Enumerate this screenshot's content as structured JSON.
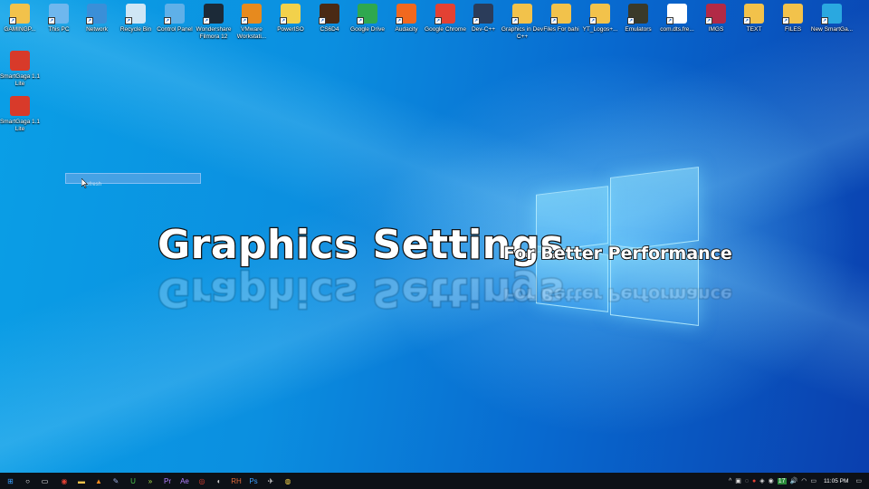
{
  "desktop": {
    "icons_top": [
      {
        "label": "GAMINGP...",
        "icon": "user-folder-icon",
        "color": "#f2c24b"
      },
      {
        "label": "This PC",
        "icon": "laptop-icon",
        "color": "#6fb7ee"
      },
      {
        "label": "Network",
        "icon": "network-globe-icon",
        "color": "#3a8fd8"
      },
      {
        "label": "Recycle Bin",
        "icon": "recycle-bin-icon",
        "color": "#cfe6f5"
      },
      {
        "label": "Control Panel",
        "icon": "control-panel-icon",
        "color": "#5fb0e8"
      },
      {
        "label": "Wondershare Filmora 12",
        "icon": "filmora-icon",
        "color": "#1c2a38"
      },
      {
        "label": "VMware Workstati...",
        "icon": "vmware-icon",
        "color": "#e78a1e"
      },
      {
        "label": "PowerISO",
        "icon": "poweriso-icon",
        "color": "#f2d14b"
      },
      {
        "label": "CS6D4",
        "icon": "cs6-game-icon",
        "color": "#4a2a14"
      },
      {
        "label": "Google Drive",
        "icon": "google-drive-icon",
        "color": "#2fa84f"
      },
      {
        "label": "Audacity",
        "icon": "audacity-icon",
        "color": "#f1681e"
      },
      {
        "label": "Google Chrome",
        "icon": "chrome-icon",
        "color": "#e34133"
      },
      {
        "label": "Dev-C++",
        "icon": "devcpp-icon",
        "color": "#2b3c5a"
      },
      {
        "label": "Graphics in Dev C++",
        "icon": "folder-icon",
        "color": "#f2c24b"
      },
      {
        "label": "Files For bahi",
        "icon": "folder-icon",
        "color": "#f2c24b"
      },
      {
        "label": "YT_Logos+...",
        "icon": "folder-icon",
        "color": "#f2c24b"
      },
      {
        "label": "Emulators",
        "icon": "emulators-icon",
        "color": "#3a3a2a"
      },
      {
        "label": "com.dts.fre...",
        "icon": "file-icon",
        "color": "#ffffff"
      },
      {
        "label": "IMGS",
        "icon": "archive-icon",
        "color": "#b22a46"
      },
      {
        "label": "TEXT",
        "icon": "folder-icon",
        "color": "#f2c24b"
      },
      {
        "label": "FILES",
        "icon": "folder-icon",
        "color": "#f2c24b"
      },
      {
        "label": "New SmartGa...",
        "icon": "smartgaga-icon",
        "color": "#2aa8e0"
      }
    ],
    "icons_left": [
      {
        "label": "SmartGaga 1.1 Lite",
        "icon": "smartgaga-icon",
        "color": "#d83a2a"
      },
      {
        "label": "SmartGaga 1.1 Lite",
        "icon": "smartgaga-icon",
        "color": "#d83a2a"
      }
    ],
    "selection_text": "Refresh"
  },
  "overlay": {
    "title": "Graphics Settings",
    "subtitle": "For Better Performance"
  },
  "taskbar": {
    "apps": [
      {
        "icon": "windows-start-icon",
        "glyph": "⊞",
        "color": "#3aa0ff"
      },
      {
        "icon": "search-icon",
        "glyph": "○",
        "color": "#ffffff"
      },
      {
        "icon": "task-view-icon",
        "glyph": "▭",
        "color": "#ffffff"
      },
      {
        "icon": "chrome-icon",
        "glyph": "◉",
        "color": "#e34133"
      },
      {
        "icon": "file-explorer-icon",
        "glyph": "▬",
        "color": "#f2c24b"
      },
      {
        "icon": "vlc-icon",
        "glyph": "▲",
        "color": "#f08a1e"
      },
      {
        "icon": "pen-tool-icon",
        "glyph": "✎",
        "color": "#9ad"
      },
      {
        "icon": "upwork-icon",
        "glyph": "U",
        "color": "#4bc44b"
      },
      {
        "icon": "arrows-icon",
        "glyph": "»",
        "color": "#a8e04b"
      },
      {
        "icon": "premiere-icon",
        "glyph": "Pr",
        "color": "#b27fff"
      },
      {
        "icon": "after-effects-icon",
        "glyph": "Ae",
        "color": "#b27fff"
      },
      {
        "icon": "obs-icon",
        "glyph": "◎",
        "color": "#e34133"
      },
      {
        "icon": "browser-icon",
        "glyph": "◐",
        "color": "#cccccc"
      },
      {
        "icon": "rh-icon",
        "glyph": "RH",
        "color": "#e06a3a"
      },
      {
        "icon": "photoshop-icon",
        "glyph": "Ps",
        "color": "#3aa0ff"
      },
      {
        "icon": "bird-icon",
        "glyph": "✈",
        "color": "#dddddd"
      },
      {
        "icon": "norton-icon",
        "glyph": "◍",
        "color": "#f2d14b"
      }
    ],
    "tray": [
      {
        "icon": "chevron-up-icon",
        "glyph": "^"
      },
      {
        "icon": "tray-app-icon",
        "glyph": "▣"
      },
      {
        "icon": "tray-app-icon",
        "glyph": "◌"
      },
      {
        "icon": "red-tray-icon",
        "glyph": "●"
      },
      {
        "icon": "tray-app-icon",
        "glyph": "◈"
      },
      {
        "icon": "tray-app-icon",
        "glyph": "◉"
      },
      {
        "icon": "badge-icon",
        "glyph": "17"
      },
      {
        "icon": "volume-icon",
        "glyph": "🔊"
      },
      {
        "icon": "wifi-icon",
        "glyph": "◠"
      },
      {
        "icon": "battery-icon",
        "glyph": "▭"
      }
    ],
    "clock": "11:05 PM",
    "notification_icon": "notification-icon"
  }
}
